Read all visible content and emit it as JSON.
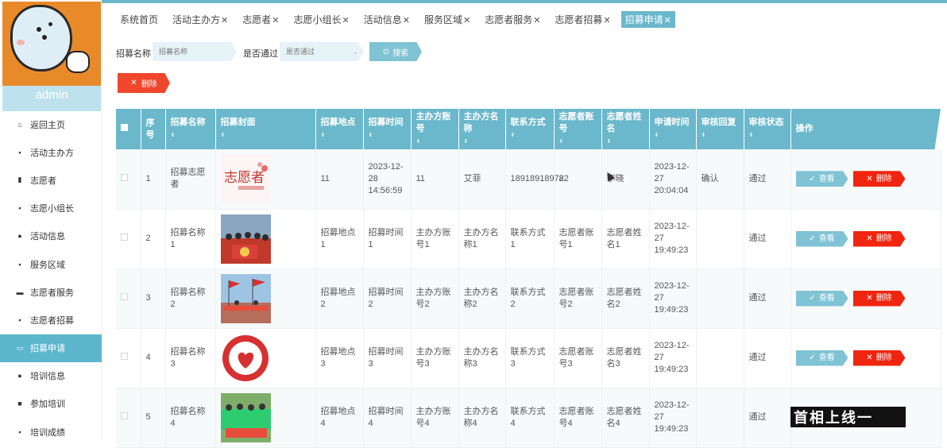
{
  "sidebar": {
    "username": "admin",
    "items": [
      {
        "label": "返回主页",
        "icon": "home-icon",
        "glyph": "⌂"
      },
      {
        "label": "活动主办方",
        "icon": "grid-icon",
        "glyph": "▪"
      },
      {
        "label": "志愿者",
        "icon": "bar-chart-icon",
        "glyph": "▮"
      },
      {
        "label": "志愿小组长",
        "icon": "grid-icon",
        "glyph": "▪"
      },
      {
        "label": "活动信息",
        "icon": "map-pin-icon",
        "glyph": "●"
      },
      {
        "label": "服务区域",
        "icon": "grid-icon",
        "glyph": "▪"
      },
      {
        "label": "志愿者服务",
        "icon": "ticket-icon",
        "glyph": "▬"
      },
      {
        "label": "志愿者招募",
        "icon": "grid-icon",
        "glyph": "▪"
      },
      {
        "label": "招募申请",
        "icon": "inbox-icon",
        "glyph": "▭"
      },
      {
        "label": "培训信息",
        "icon": "user-icon",
        "glyph": "●"
      },
      {
        "label": "参加培训",
        "icon": "chat-icon",
        "glyph": "■"
      },
      {
        "label": "培训成绩",
        "icon": "grid-icon",
        "glyph": "▪"
      }
    ],
    "active_index": 8
  },
  "tabs": [
    {
      "label": "系统首页",
      "closable": false
    },
    {
      "label": "活动主办方",
      "closable": true
    },
    {
      "label": "志愿者",
      "closable": true
    },
    {
      "label": "志愿小组长",
      "closable": true
    },
    {
      "label": "活动信息",
      "closable": true
    },
    {
      "label": "服务区域",
      "closable": true
    },
    {
      "label": "志愿者服务",
      "closable": true
    },
    {
      "label": "志愿者招募",
      "closable": true
    },
    {
      "label": "招募申请",
      "closable": true,
      "active": true
    }
  ],
  "search": {
    "name_label": "招募名称",
    "name_placeholder": "招募名称",
    "pass_label": "是否通过",
    "pass_placeholder": "是否通过",
    "search_button": "搜索",
    "delete_button": "删除"
  },
  "table": {
    "columns": [
      "序号",
      "招募名称",
      "招募封面",
      "招募地点",
      "招募时间",
      "主办方账号",
      "主办方名称",
      "联系方式",
      "志愿者账号",
      "志愿者姓名",
      "申请时间",
      "审核回复",
      "审核状态",
      "操作"
    ],
    "rows": [
      {
        "index": "1",
        "name": "招募志愿者",
        "cover": "volunteer-logo",
        "place": "11",
        "time": "2023-12-28 14:56:59",
        "host_account": "11",
        "host_name": "艾菲",
        "contact": "18918918978",
        "vol_account": "22",
        "vol_name": "李晓",
        "apply_time": "2023-12-27 20:04:04",
        "reply": "确认",
        "status": "通过"
      },
      {
        "index": "2",
        "name": "招募名称1",
        "cover": "group-photo",
        "place": "招募地点1",
        "time": "招募时间1",
        "host_account": "主办方账号1",
        "host_name": "主办方名称1",
        "contact": "联系方式1",
        "vol_account": "志愿者账号1",
        "vol_name": "志愿者姓名1",
        "apply_time": "2023-12-27 19:49:23",
        "reply": "",
        "status": "通过"
      },
      {
        "index": "3",
        "name": "招募名称2",
        "cover": "flag-photo",
        "place": "招募地点2",
        "time": "招募时间2",
        "host_account": "主办方账号2",
        "host_name": "主办方名称2",
        "contact": "联系方式2",
        "vol_account": "志愿者账号2",
        "vol_name": "志愿者姓名2",
        "apply_time": "2023-12-27 19:49:23",
        "reply": "",
        "status": "通过"
      },
      {
        "index": "4",
        "name": "招募名称3",
        "cover": "heart-badge",
        "place": "招募地点3",
        "time": "招募时间3",
        "host_account": "主办方账号3",
        "host_name": "主办方名称3",
        "contact": "联系方式3",
        "vol_account": "志愿者账号3",
        "vol_name": "志愿者姓名3",
        "apply_time": "2023-12-27 19:49:23",
        "reply": "",
        "status": "通过"
      },
      {
        "index": "5",
        "name": "招募名称4",
        "cover": "team-photo",
        "place": "招募地点4",
        "time": "招募时间4",
        "host_account": "主办方账号4",
        "host_name": "主办方名称4",
        "contact": "联系方式4",
        "vol_account": "志愿者账号4",
        "vol_name": "志愿者姓名4",
        "apply_time": "2023-12-27 19:49:23",
        "reply": "",
        "status": "通过"
      }
    ],
    "view_label": "查看",
    "delete_label": "删除"
  },
  "watermark": "首相上线一"
}
